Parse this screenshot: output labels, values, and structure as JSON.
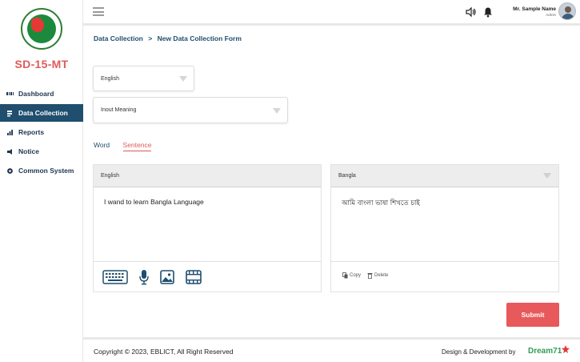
{
  "brand": {
    "name": "SD-15-MT"
  },
  "sidebar": {
    "items": [
      {
        "label": "Dashboard",
        "icon": "dashboard-icon",
        "active": false
      },
      {
        "label": "Data Collection",
        "icon": "data-collection-icon",
        "active": true
      },
      {
        "label": "Reports",
        "icon": "bar-chart-icon",
        "active": false
      },
      {
        "label": "Notice",
        "icon": "megaphone-icon",
        "active": false
      },
      {
        "label": "Common System",
        "icon": "gear-icon",
        "active": false
      }
    ]
  },
  "header": {
    "user_name": "Mr. Sample Name",
    "user_role": "Admin",
    "icons": [
      "menu-icon",
      "speaker-icon",
      "bell-icon",
      "avatar"
    ]
  },
  "breadcrumb": {
    "parent": "Data Collection",
    "separator": ">",
    "current": "New Data Collection Form"
  },
  "form": {
    "language_select": "English",
    "type_select": "Inout Meaning",
    "tabs": [
      {
        "label": "Word",
        "active": false
      },
      {
        "label": "Sentence",
        "active": true
      }
    ],
    "source": {
      "language": "English",
      "text": "I wand to learn Bangla Language",
      "tool_icons": [
        "keyboard-icon",
        "microphone-icon",
        "image-icon",
        "video-icon"
      ]
    },
    "target": {
      "language": "Bangla",
      "text": "আমি বাংলা ভাষা শিখতে চাই",
      "copy_label": "Copy",
      "delete_label": "Delete"
    },
    "submit_label": "Submit"
  },
  "footer": {
    "copyright": "Copyright © 2023, EBLICT, All Right Reserved",
    "credit": "Design & Development by",
    "company": "Dream71"
  },
  "colors": {
    "primary": "#1f4e6e",
    "accent": "#e05a5a",
    "submit": "#e8595b",
    "brand_green": "#2e9d55"
  }
}
